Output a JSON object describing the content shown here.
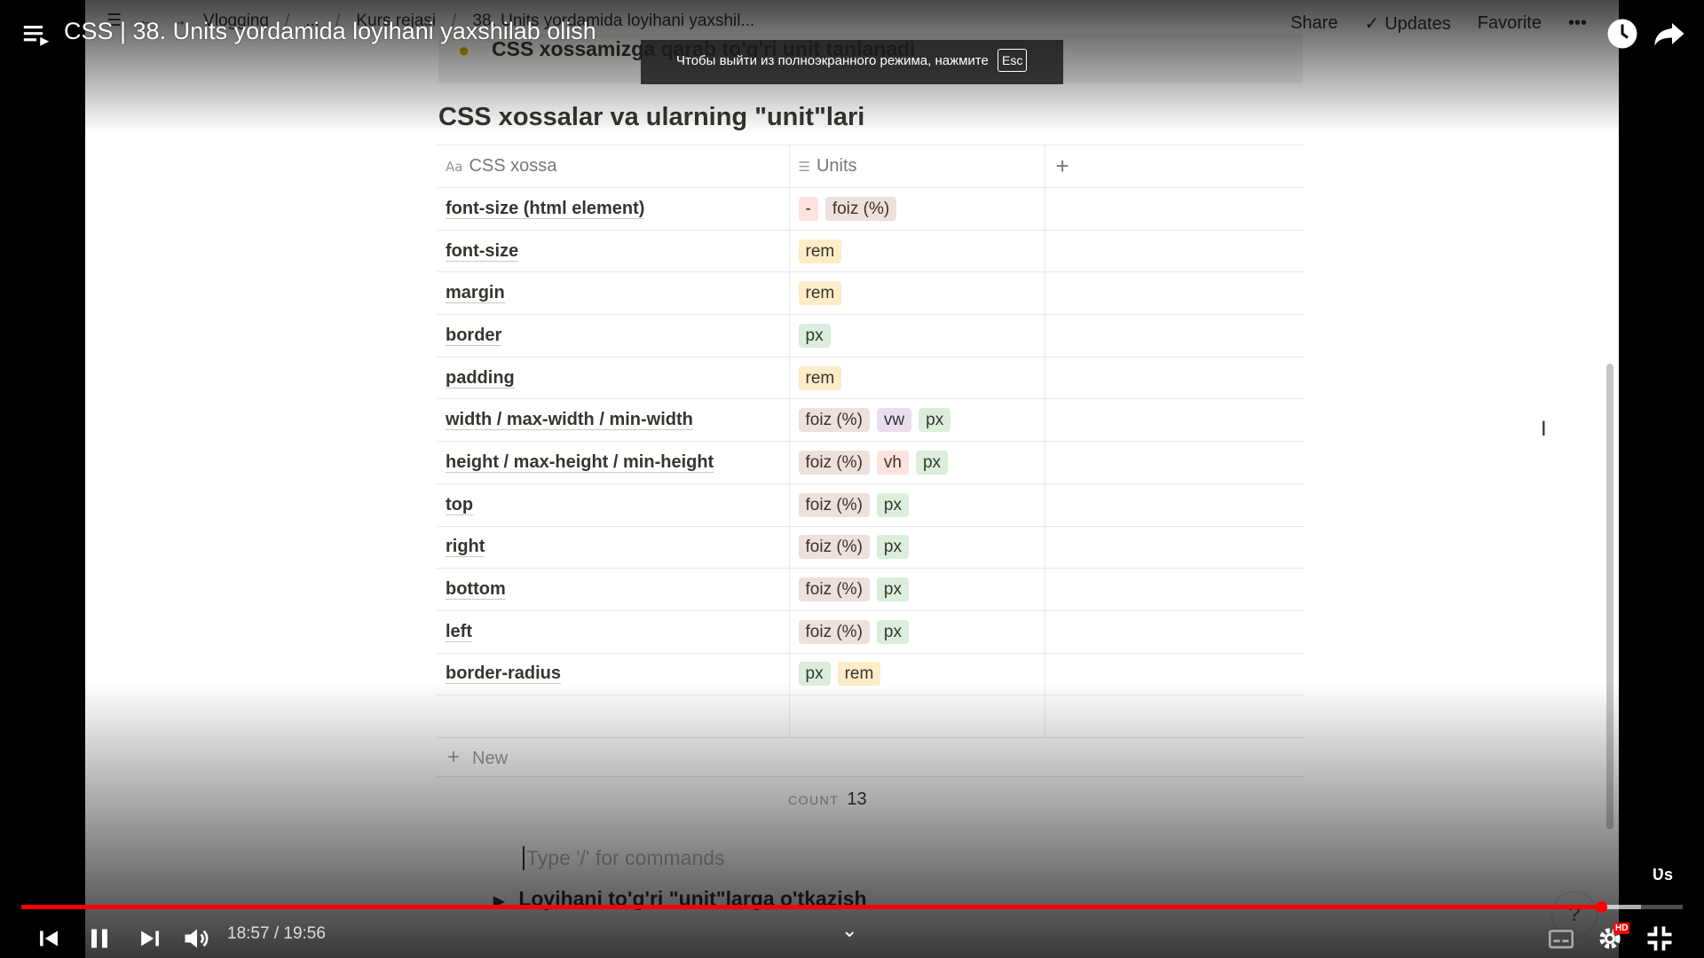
{
  "video": {
    "title": "CSS | 38. Units yordamida loyihani yaxshilab olish",
    "current_time": "18:57",
    "duration": "19:56",
    "time_display": "18:57 / 19:56",
    "progress": 0.9507,
    "buffered": 0.975,
    "fullscreen_toast": "Чтобы выйти из полноэкранного режима, нажмите",
    "toast_key": "Esc",
    "hd_label": "HD",
    "side_label": "Ʋs"
  },
  "notion": {
    "breadcrumbs": [
      "Vlogging",
      "/",
      "...",
      "/",
      "Kurs rejasi",
      "/",
      "38. Units yordamida loyihani yaxshil..."
    ],
    "actions": {
      "share": "Share",
      "updates": "Updates",
      "favorite": "Favorite",
      "more": "•••"
    },
    "callout_text": "CSS xossamizga qarab to'g'ri unit tanlanadi",
    "db_title": "CSS xossalar va ularning \"unit\"lari",
    "columns": {
      "prop": "CSS xossa",
      "units": "Units",
      "add": "+"
    },
    "column_icons": {
      "prop": "Aa",
      "units": "☰"
    },
    "rows": [
      {
        "name": "font-size (html element)",
        "tags": [
          {
            "t": "-",
            "c": "#ffe2dd"
          },
          {
            "t": "foiz (%)",
            "c": "#eee0da"
          }
        ]
      },
      {
        "name": "font-size",
        "tags": [
          {
            "t": "rem",
            "c": "#fdecc8"
          }
        ]
      },
      {
        "name": "margin",
        "tags": [
          {
            "t": "rem",
            "c": "#fdecc8"
          }
        ]
      },
      {
        "name": "border",
        "tags": [
          {
            "t": "px",
            "c": "#dbeddb"
          }
        ]
      },
      {
        "name": "padding",
        "tags": [
          {
            "t": "rem",
            "c": "#fdecc8"
          }
        ]
      },
      {
        "name": "width / max-width / min-width",
        "tags": [
          {
            "t": "foiz (%)",
            "c": "#eee0da"
          },
          {
            "t": "vw",
            "c": "#e8deee"
          },
          {
            "t": "px",
            "c": "#dbeddb"
          }
        ]
      },
      {
        "name": "height / max-height / min-height",
        "tags": [
          {
            "t": "foiz (%)",
            "c": "#eee0da"
          },
          {
            "t": "vh",
            "c": "#ffe2dd"
          },
          {
            "t": "px",
            "c": "#dbeddb"
          }
        ]
      },
      {
        "name": "top",
        "tags": [
          {
            "t": "foiz (%)",
            "c": "#eee0da"
          },
          {
            "t": "px",
            "c": "#dbeddb"
          }
        ]
      },
      {
        "name": "right",
        "tags": [
          {
            "t": "foiz (%)",
            "c": "#eee0da"
          },
          {
            "t": "px",
            "c": "#dbeddb"
          }
        ]
      },
      {
        "name": "bottom",
        "tags": [
          {
            "t": "foiz (%)",
            "c": "#eee0da"
          },
          {
            "t": "px",
            "c": "#dbeddb"
          }
        ]
      },
      {
        "name": "left",
        "tags": [
          {
            "t": "foiz (%)",
            "c": "#eee0da"
          },
          {
            "t": "px",
            "c": "#dbeddb"
          }
        ]
      },
      {
        "name": "border-radius",
        "tags": [
          {
            "t": "px",
            "c": "#dbeddb"
          },
          {
            "t": "rem",
            "c": "#fdecc8"
          }
        ]
      }
    ],
    "new_label": "New",
    "count_label": "COUNT",
    "count_value": "13",
    "command_placeholder": "Type '/' for commands",
    "toggle_text": "Loyihani to'g'ri \"unit\"larga o'tkazish",
    "help": "?"
  },
  "colors": {
    "accent_red": "#ff0000",
    "text": "#37352f",
    "muted": "#9b9a97"
  }
}
